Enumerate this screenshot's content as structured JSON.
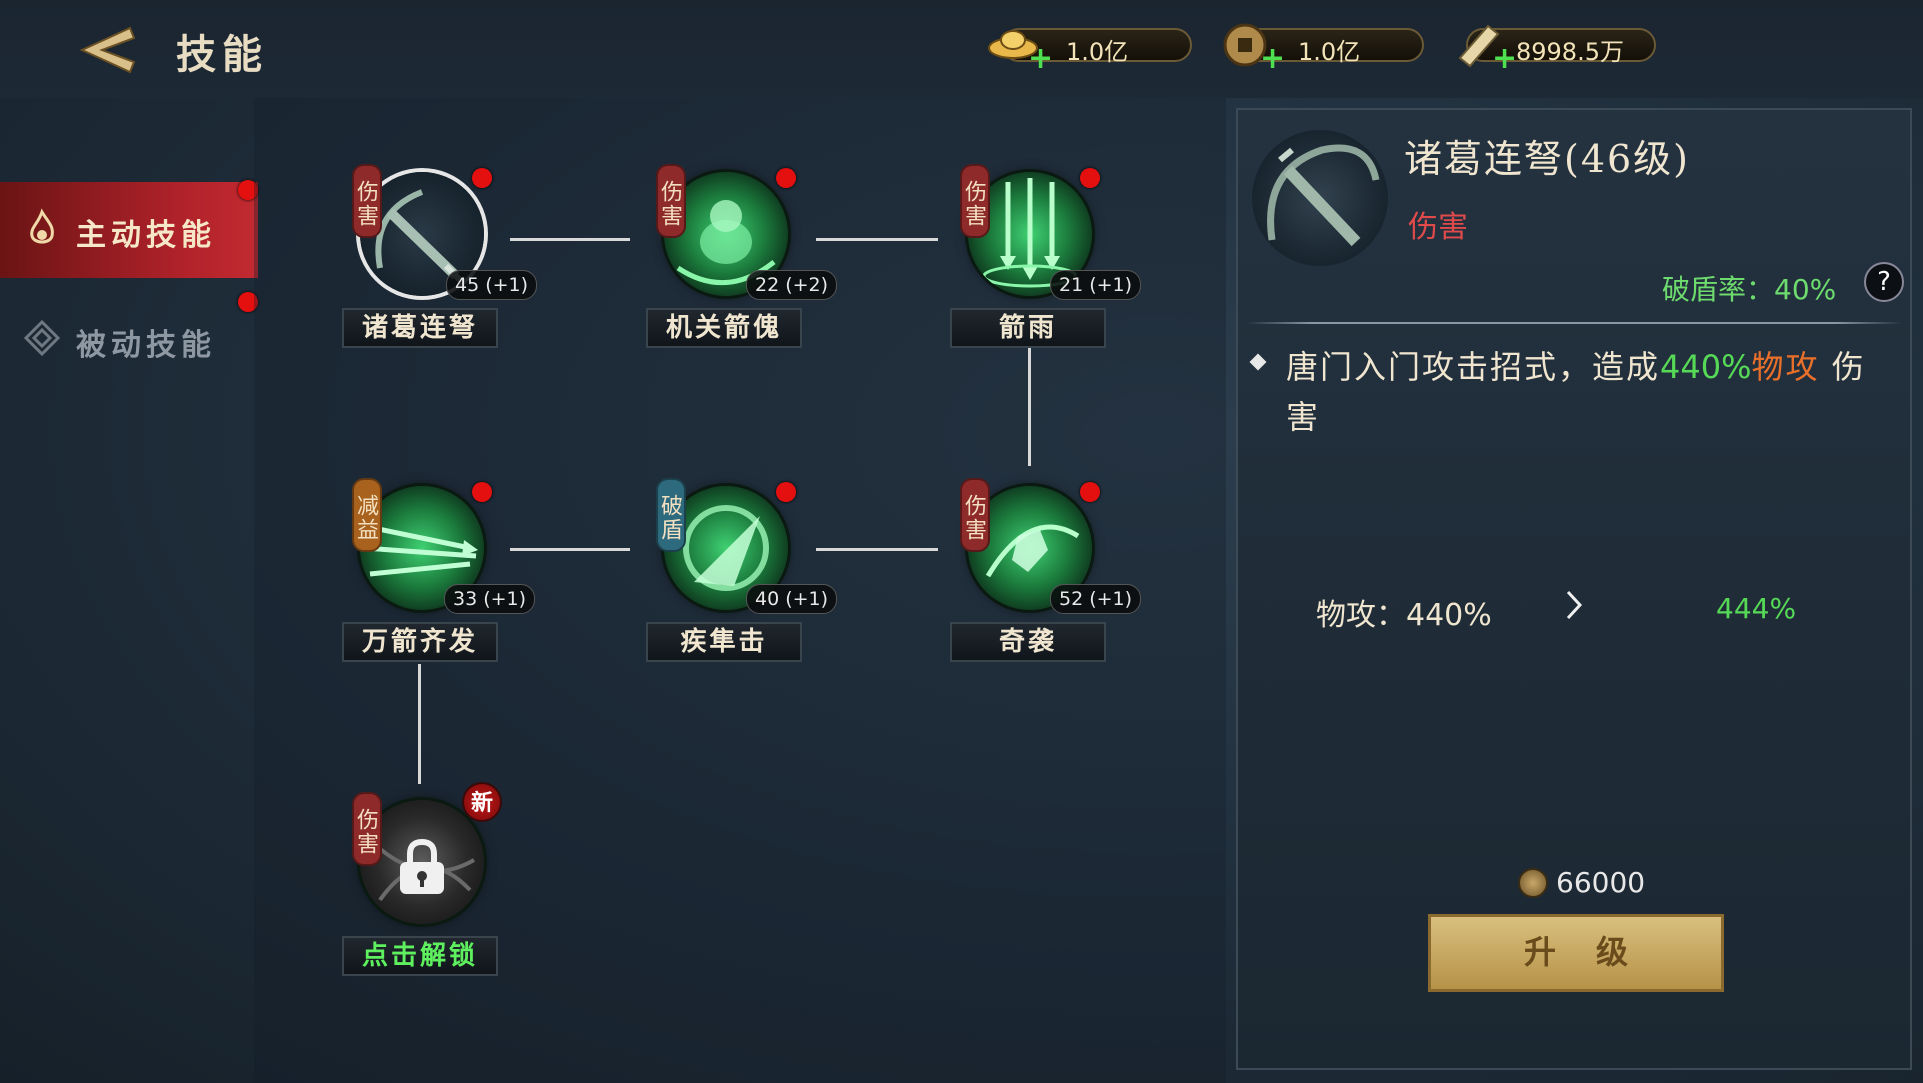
{
  "header": {
    "title": "技能",
    "currencies": [
      {
        "icon": "gold-ingot-icon",
        "value": "1.0亿"
      },
      {
        "icon": "copper-coin-icon",
        "value": "1.0亿"
      },
      {
        "icon": "scroll-icon",
        "value": "8998.5万"
      }
    ]
  },
  "tabs": [
    {
      "label": "主动技能",
      "active": true
    },
    {
      "label": "被动技能",
      "active": false
    }
  ],
  "skills": [
    {
      "name": "诸葛连弩",
      "tag": "伤害",
      "level": "45 (+1)",
      "red_dot": true,
      "selected": true
    },
    {
      "name": "机关箭傀",
      "tag": "伤害",
      "level": "22 (+2)",
      "red_dot": true
    },
    {
      "name": "箭雨",
      "tag": "伤害",
      "level": "21 (+1)",
      "red_dot": true
    },
    {
      "name": "万箭齐发",
      "tag": "减益",
      "level": "33 (+1)",
      "red_dot": true
    },
    {
      "name": "疾隼击",
      "tag": "破盾",
      "level": "40 (+1)",
      "red_dot": true
    },
    {
      "name": "奇袭",
      "tag": "伤害",
      "level": "52 (+1)",
      "red_dot": true
    },
    {
      "name": "点击解锁",
      "tag": "伤害",
      "locked": true,
      "badge": "新"
    }
  ],
  "detail": {
    "name": "诸葛连弩(46级)",
    "type": "伤害",
    "shield_rate": "破盾率：40%",
    "help": "?",
    "desc_prefix": "唐门入门攻击招式，造成",
    "desc_pct": "440%",
    "desc_attr": "物攻",
    "desc_suffix": "伤害",
    "stat_label": "物攻：",
    "stat_current": "440%",
    "stat_next": "444%",
    "cost": "66000",
    "upgrade_label": "升级"
  },
  "colors": {
    "accent_red": "#b0222a",
    "skill_green": "#3fd072",
    "text_green": "#56d956",
    "text_orange": "#e8702a",
    "damage_red": "#e04a4a",
    "upgrade_gold": "#d9bf7e"
  }
}
